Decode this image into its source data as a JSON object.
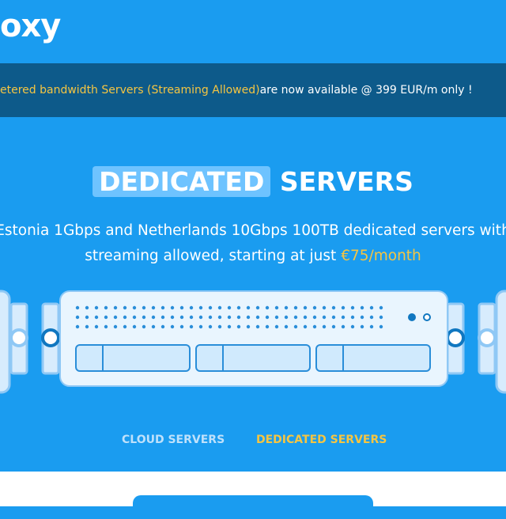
{
  "header": {
    "logo_text": "oxy"
  },
  "banner": {
    "highlight": "etered bandwidth Servers (Streaming Allowed)",
    "rest": " are now available @ 399 EUR/m only !"
  },
  "hero": {
    "title_boxed": "DEDICATED",
    "title_rest": "SERVERS",
    "desc_line1": "Estonia 1Gbps and Netherlands 10Gbps 100TB dedicated servers with",
    "desc_line2": "streaming allowed, starting at just",
    "price": "€75/month"
  },
  "tabs": [
    {
      "label": "CLOUD SERVERS",
      "active": false
    },
    {
      "label": "DEDICATED SERVERS",
      "active": true
    }
  ],
  "colors": {
    "background": "#1a9cf0",
    "banner": "#0d5a8a",
    "accent": "#f5c542"
  }
}
